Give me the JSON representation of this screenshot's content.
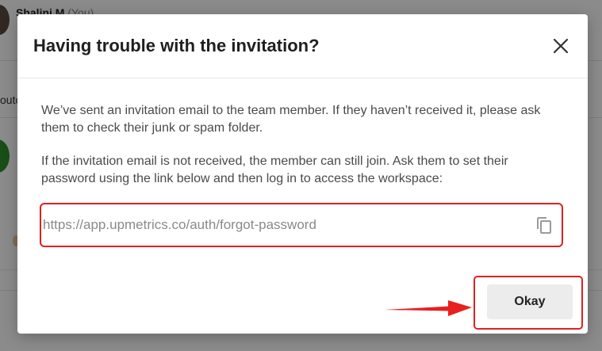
{
  "background": {
    "user_name": "Shalini M",
    "user_tag": "(You)",
    "side_text": "outc"
  },
  "modal": {
    "title": "Having trouble with the invitation?",
    "paragraph_1": "We’ve sent an invitation email to the team member. If they haven’t received it, please ask them to check their junk or spam folder.",
    "paragraph_2": "If the invitation email is not received, the member can still join. Ask them to set their password using the link below and then log in to access the workspace:",
    "link_value": "https://app.upmetrics.co/auth/forgot-password",
    "okay_label": "Okay"
  },
  "icons": {
    "close": "close-icon",
    "copy": "copy-icon",
    "arrow": "arrow-annotation"
  },
  "colors": {
    "highlight": "#e02020",
    "button_bg": "#ececec",
    "text": "#4a4a4a",
    "title": "#1f1f1f"
  }
}
